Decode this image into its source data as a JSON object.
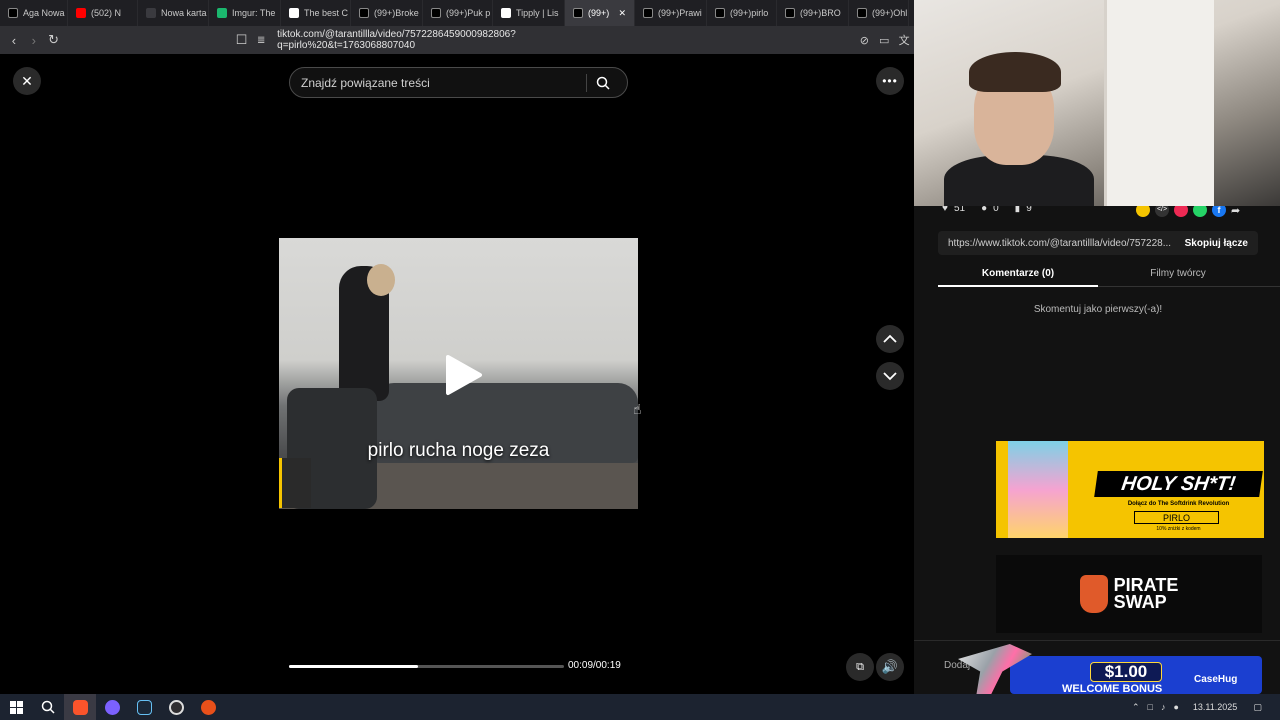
{
  "browser": {
    "tabs": [
      {
        "label": "Aga Nowa",
        "icon": "tiktok-icon",
        "color": "#000000"
      },
      {
        "label": "(502) N",
        "icon": "youtube-icon",
        "color": "#ff0000"
      },
      {
        "label": "Nowa karta",
        "icon": "blank-icon",
        "color": "#3a3a3f"
      },
      {
        "label": "Imgur: The",
        "icon": "imgur-icon",
        "color": "#1bb76e"
      },
      {
        "label": "The best C",
        "icon": "diamond-icon",
        "color": "#ffffff"
      },
      {
        "label": "(99+)Broke",
        "icon": "tiktok-icon",
        "color": "#000000"
      },
      {
        "label": "(99+)Puk p",
        "icon": "tiktok-icon",
        "color": "#000000"
      },
      {
        "label": "Tipply | Lis",
        "icon": "tipply-icon",
        "color": "#ffffff"
      },
      {
        "label": "(99+)",
        "icon": "tiktok-icon",
        "color": "#000000"
      },
      {
        "label": "(99+)Prawi",
        "icon": "tiktok-icon",
        "color": "#000000"
      },
      {
        "label": "(99+)pirlo",
        "icon": "tiktok-icon",
        "color": "#000000"
      },
      {
        "label": "(99+)BRO",
        "icon": "tiktok-icon",
        "color": "#000000"
      },
      {
        "label": "(99+)Ohl",
        "icon": "tiktok-icon",
        "color": "#000000"
      }
    ],
    "url": "tiktok.com/@tarantillla/video/7572286459000982806?q=pirlo%20&t=1763068807040"
  },
  "player": {
    "search_placeholder": "Znajdź powiązane treści",
    "caption": "pirlo rucha noge zeza",
    "progress": 0.47,
    "time": "00:09/00:19"
  },
  "sidebar": {
    "likes": "51",
    "comments": "0",
    "saves": "9",
    "link": "https://www.tiktok.com/@tarantillla/video/757228...",
    "copy_label": "Skopiuj łącze",
    "tab_comments": "Komentarze (0)",
    "tab_creator": "Filmy twórcy",
    "empty_comments": "Skomentuj jako pierwszy(-a)!",
    "add_comment": "Dodaj"
  },
  "ads": {
    "holy_title": "HOLY SH*T!",
    "holy_sub": "Dołącz do The Softdrink Revolution",
    "holy_code": "PIRLO",
    "holy_discount": "10% zniżki z kodem",
    "pirate_line1": "PIRATE",
    "pirate_line2": "SWAP",
    "bonus_price": "$1.00",
    "bonus_text": "WELCOME BONUS",
    "casehug": "CaseHug"
  },
  "taskbar": {
    "date": "13.11.2025"
  },
  "colors": {
    "ad_yellow": "#f5c400",
    "bonus_blue": "#1b3fd0"
  }
}
